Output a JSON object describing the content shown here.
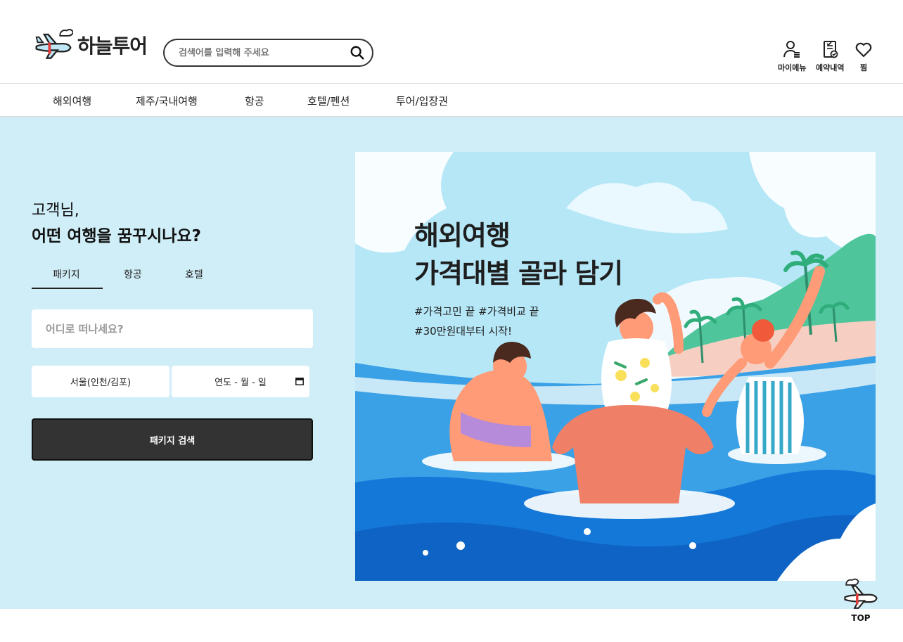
{
  "header": {
    "logo_text": "하늘투어",
    "search_placeholder": "검색어를 입력해 주세요",
    "utils": [
      {
        "label": "마이메뉴",
        "icon": "user-menu-icon"
      },
      {
        "label": "예약내역",
        "icon": "clipboard-check-icon"
      },
      {
        "label": "찜",
        "icon": "heart-icon"
      }
    ]
  },
  "nav": {
    "items": [
      "해외여행",
      "제주/국내여행",
      "항공",
      "호텔/펜션",
      "투어/입장권"
    ]
  },
  "search_panel": {
    "greeting_line1": "고객님,",
    "greeting_line2": "어떤 여행을 꿈꾸시나요?",
    "tabs": [
      "패키지",
      "항공",
      "호텔"
    ],
    "active_tab": "패키지",
    "destination_placeholder": "어디로 떠나세요?",
    "departure": "서울(인천/김포)",
    "date_placeholder": "연도 - 월 - 일",
    "search_button": "패키지 검색"
  },
  "banner": {
    "title_line1": "해외여행",
    "title_line2": "가격대별 골라 담기",
    "tag_line1": "#가격고민 끝 #가격비교 끝",
    "tag_line2": "#30만원대부터 시작!"
  },
  "top_button": {
    "label": "TOP"
  },
  "colors": {
    "hero_background": "#d0eef8",
    "search_button": "#333333",
    "accent_red": "#e43b3b"
  }
}
